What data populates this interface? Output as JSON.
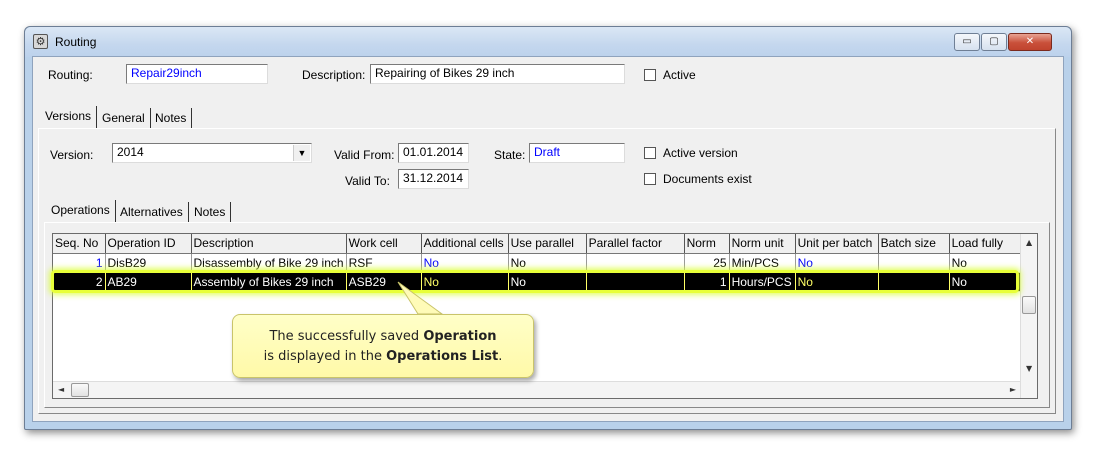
{
  "window": {
    "title": "Routing",
    "controls": {
      "minimize": "▭",
      "maximize": "▢",
      "close": "✕"
    }
  },
  "routing": {
    "routing_label": "Routing:",
    "routing_value": "Repair29inch",
    "description_label": "Description:",
    "description_value": "Repairing of Bikes 29 inch",
    "active_label": "Active",
    "active_checked": false
  },
  "outer_tabs": [
    "Versions",
    "General",
    "Notes"
  ],
  "version": {
    "version_label": "Version:",
    "version_value": "2014",
    "valid_from_label": "Valid From:",
    "valid_from_value": "01.01.2014",
    "valid_to_label": "Valid To:",
    "valid_to_value": "31.12.2014",
    "state_label": "State:",
    "state_value": "Draft",
    "active_version_label": "Active version",
    "documents_exist_label": "Documents exist"
  },
  "inner_tabs": [
    "Operations",
    "Alternatives",
    "Notes"
  ],
  "operations": {
    "columns": [
      "Seq. No",
      "Operation ID",
      "Description",
      "Work cell",
      "Additional cells",
      "Use parallel",
      "Parallel factor",
      "Norm",
      "Norm unit",
      "Unit per batch",
      "Batch size",
      "Load fully"
    ],
    "rows": [
      {
        "seq": "1",
        "op_id": "DisB29",
        "description": "Disassembly of Bike 29 inch",
        "work_cell": "RSF",
        "additional_cells": "No",
        "use_parallel": "No",
        "parallel_factor": "",
        "norm": "25",
        "norm_unit": "Min/PCS",
        "unit_per_batch": "No",
        "batch_size": "",
        "load_fully": "No"
      },
      {
        "seq": "2",
        "op_id": "AB29",
        "description": "Assembly of Bikes 29 inch",
        "work_cell": "ASB29",
        "additional_cells": "No",
        "use_parallel": "No",
        "parallel_factor": "",
        "norm": "1",
        "norm_unit": "Hours/PCS",
        "unit_per_batch": "No",
        "batch_size": "",
        "load_fully": "No"
      }
    ],
    "selected_row": 1
  },
  "callout": {
    "line1_pre": "The successfully saved ",
    "line1_bold": "Operation",
    "line2_pre": "is displayed in the ",
    "line2_bold": "Operations List",
    "line2_post": "."
  },
  "colors": {
    "blue_value": "#0000ff",
    "highlight": "#e8ff38",
    "callout_bg": "#fff9a8"
  }
}
